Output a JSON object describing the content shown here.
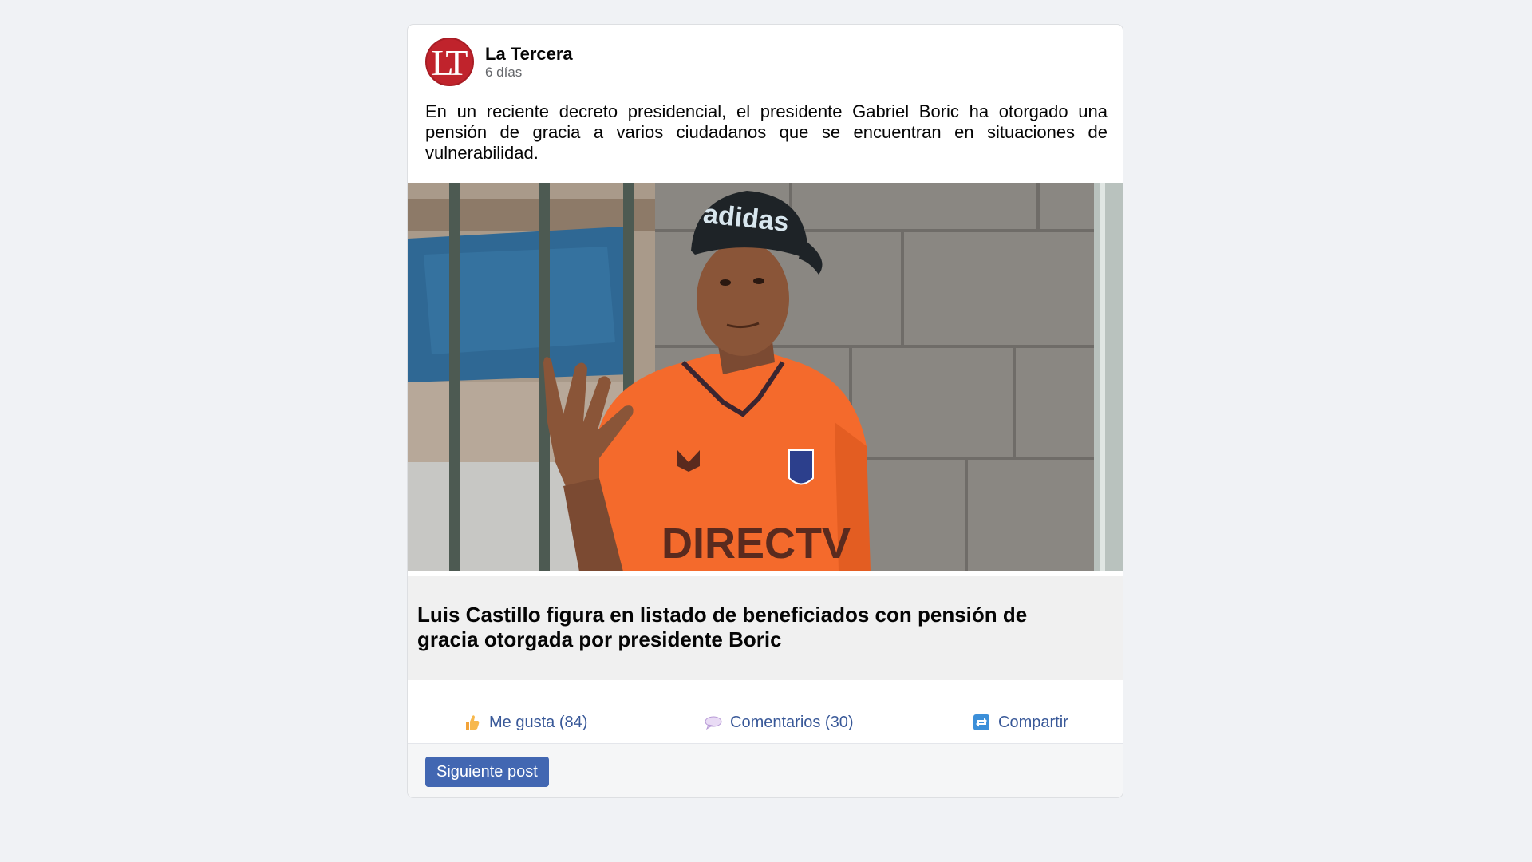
{
  "post": {
    "author": "La Tercera",
    "avatar_text": "LT",
    "time": "6 días",
    "text": "En un reciente decreto presidencial, el presidente Gabriel Boric ha otorgado una pensión de gracia a varios ciudadanos que se encuentran en situaciones de vulnerabilidad.",
    "photo": {
      "cap_text": "adidas",
      "shirt_text": "DIRECTV"
    },
    "link_title": "Luis Castillo figura en listado de beneficiados con pensión de gracia otorgada por presidente Boric"
  },
  "actions": {
    "like": {
      "icon": "thumbs-up-icon",
      "label": "Me gusta (84)"
    },
    "comment": {
      "icon": "speech-bubble-icon",
      "label": "Comentarios (30)"
    },
    "share": {
      "icon": "share-icon",
      "label": "Compartir"
    }
  },
  "footer": {
    "next_label": "Siguiente post"
  },
  "colors": {
    "brand_red": "#c0232c",
    "link_blue": "#385898",
    "button_blue": "#4267b2",
    "page_bg": "#f0f2f5"
  }
}
